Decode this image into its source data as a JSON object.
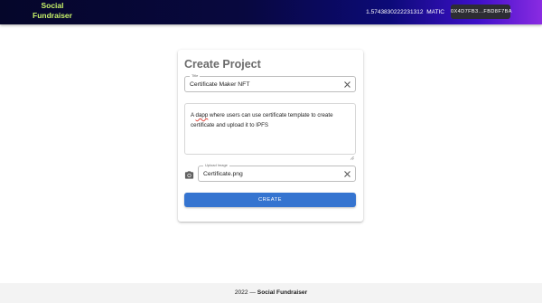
{
  "header": {
    "brand_line1": "Social",
    "brand_line2": "Fundraiser",
    "balance_amount": "1.5743830222231312",
    "balance_unit": "MATIC",
    "wallet_address": "0X4D7FB3...FBD8F7BA"
  },
  "form": {
    "heading": "Create Project",
    "title_field": {
      "label": "Title",
      "value": "Certificate Maker NFT"
    },
    "description_field": {
      "text_before": "A ",
      "misspelled_word": "dapp",
      "text_after": " where users can use certificate template to create certificate and upload it to IPFS"
    },
    "upload_field": {
      "label": "Upload Image",
      "value": "Certificate.png"
    },
    "submit_label": "CREATE"
  },
  "footer": {
    "year": "2022",
    "separator": "—",
    "brand": "Social Fundraiser"
  },
  "colors": {
    "brand_text": "#c8f26a",
    "primary_button": "#3574d0",
    "wallet_button": "#2d2d33",
    "footer_background": "#f3f3f3"
  },
  "icons": {
    "clear": "close-icon",
    "camera": "camera-icon",
    "resize": "resize-grip-icon"
  }
}
